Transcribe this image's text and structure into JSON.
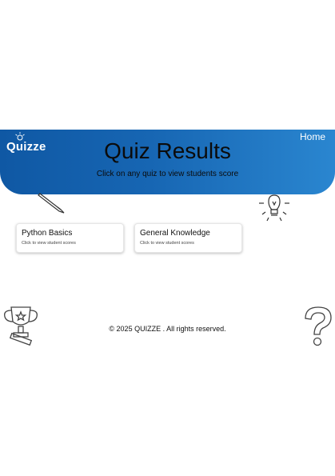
{
  "nav": {
    "logo": "Quizze",
    "home_label": "Home"
  },
  "header": {
    "title": "Quiz Results",
    "subtitle": "Click on any quiz to view students score"
  },
  "quizzes": [
    {
      "name": "Python Basics",
      "hint": "Click to view student scores"
    },
    {
      "name": "General Knowledge",
      "hint": "Click to view student scores"
    }
  ],
  "footer": {
    "copyright_symbol": "©",
    "text": "2025 QUIZZE . All rights reserved."
  },
  "colors": {
    "header_start": "#0f58a4",
    "header_end": "#2a86d0",
    "text": "#0b0b0b"
  },
  "decorations": [
    "pencil-icon",
    "lightbulb-icon",
    "trophy-icon",
    "question-mark-icon"
  ]
}
